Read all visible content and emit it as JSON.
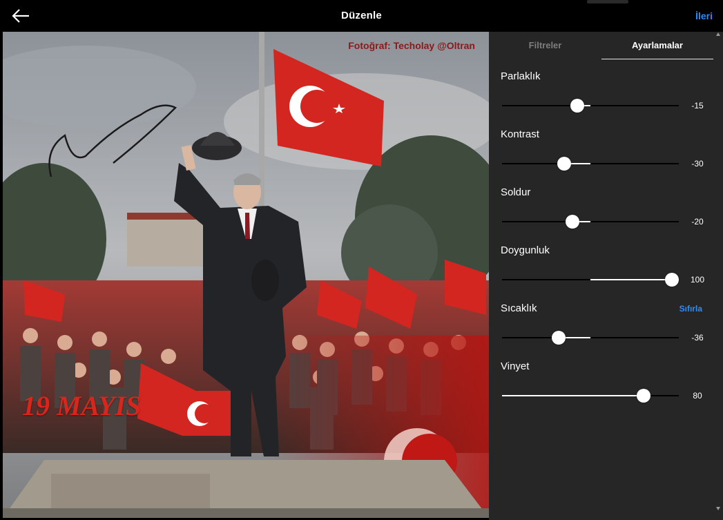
{
  "header": {
    "title": "Düzenle",
    "next_label": "İleri",
    "back_icon": "arrow-left-icon"
  },
  "photo": {
    "credit": "Fotoğraf: Techolay @Oltran",
    "overlay_text": "19 MAYIS"
  },
  "tabs": [
    {
      "label": "Filtreler",
      "active": false
    },
    {
      "label": "Ayarlamalar",
      "active": true
    }
  ],
  "adjustments": [
    {
      "label": "Parlaklık",
      "value": -15,
      "display": "-15",
      "min": -100,
      "max": 100,
      "reset_label": ""
    },
    {
      "label": "Kontrast",
      "value": -30,
      "display": "-30",
      "min": -100,
      "max": 100,
      "reset_label": ""
    },
    {
      "label": "Soldur",
      "value": -20,
      "display": "-20",
      "min": -100,
      "max": 100,
      "reset_label": ""
    },
    {
      "label": "Doygunluk",
      "value": 100,
      "display": "100",
      "min": -100,
      "max": 100,
      "reset_label": ""
    },
    {
      "label": "Sıcaklık",
      "value": -36,
      "display": "-36",
      "min": -100,
      "max": 100,
      "reset_label": "Sıfırla"
    },
    {
      "label": "Vinyet",
      "value": 80,
      "display": "80",
      "min": 0,
      "max": 100,
      "reset_label": ""
    }
  ],
  "colors": {
    "accent": "#2f8cf5",
    "panel_bg": "#262626",
    "topbar_bg": "#000000",
    "flag_red": "#d9261c"
  }
}
